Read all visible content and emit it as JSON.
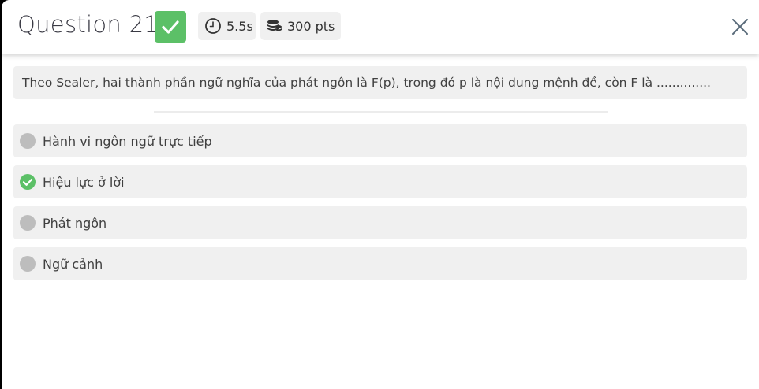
{
  "header": {
    "title": "Question 21",
    "status_icon": "check-icon",
    "time_icon": "clock-icon",
    "time": "5.5s",
    "points_icon": "coins-icon",
    "points": "300 pts",
    "close_icon": "close-icon"
  },
  "question": {
    "text": "Theo Sealer, hai thành phần ngữ nghĩa của phát ngôn là F(p), trong đó p là nội dung mệnh đề, còn F là .............."
  },
  "options": [
    {
      "label": "Hành vi ngôn ngữ trực tiếp",
      "state": "unselected"
    },
    {
      "label": "Hiệu lực ở lời",
      "state": "correct"
    },
    {
      "label": "Phát ngôn",
      "state": "unselected"
    },
    {
      "label": "Ngữ cảnh",
      "state": "unselected"
    }
  ],
  "colors": {
    "correct": "#5cc067",
    "neutral": "#bdbdbd",
    "surface": "#f0f0f0"
  }
}
